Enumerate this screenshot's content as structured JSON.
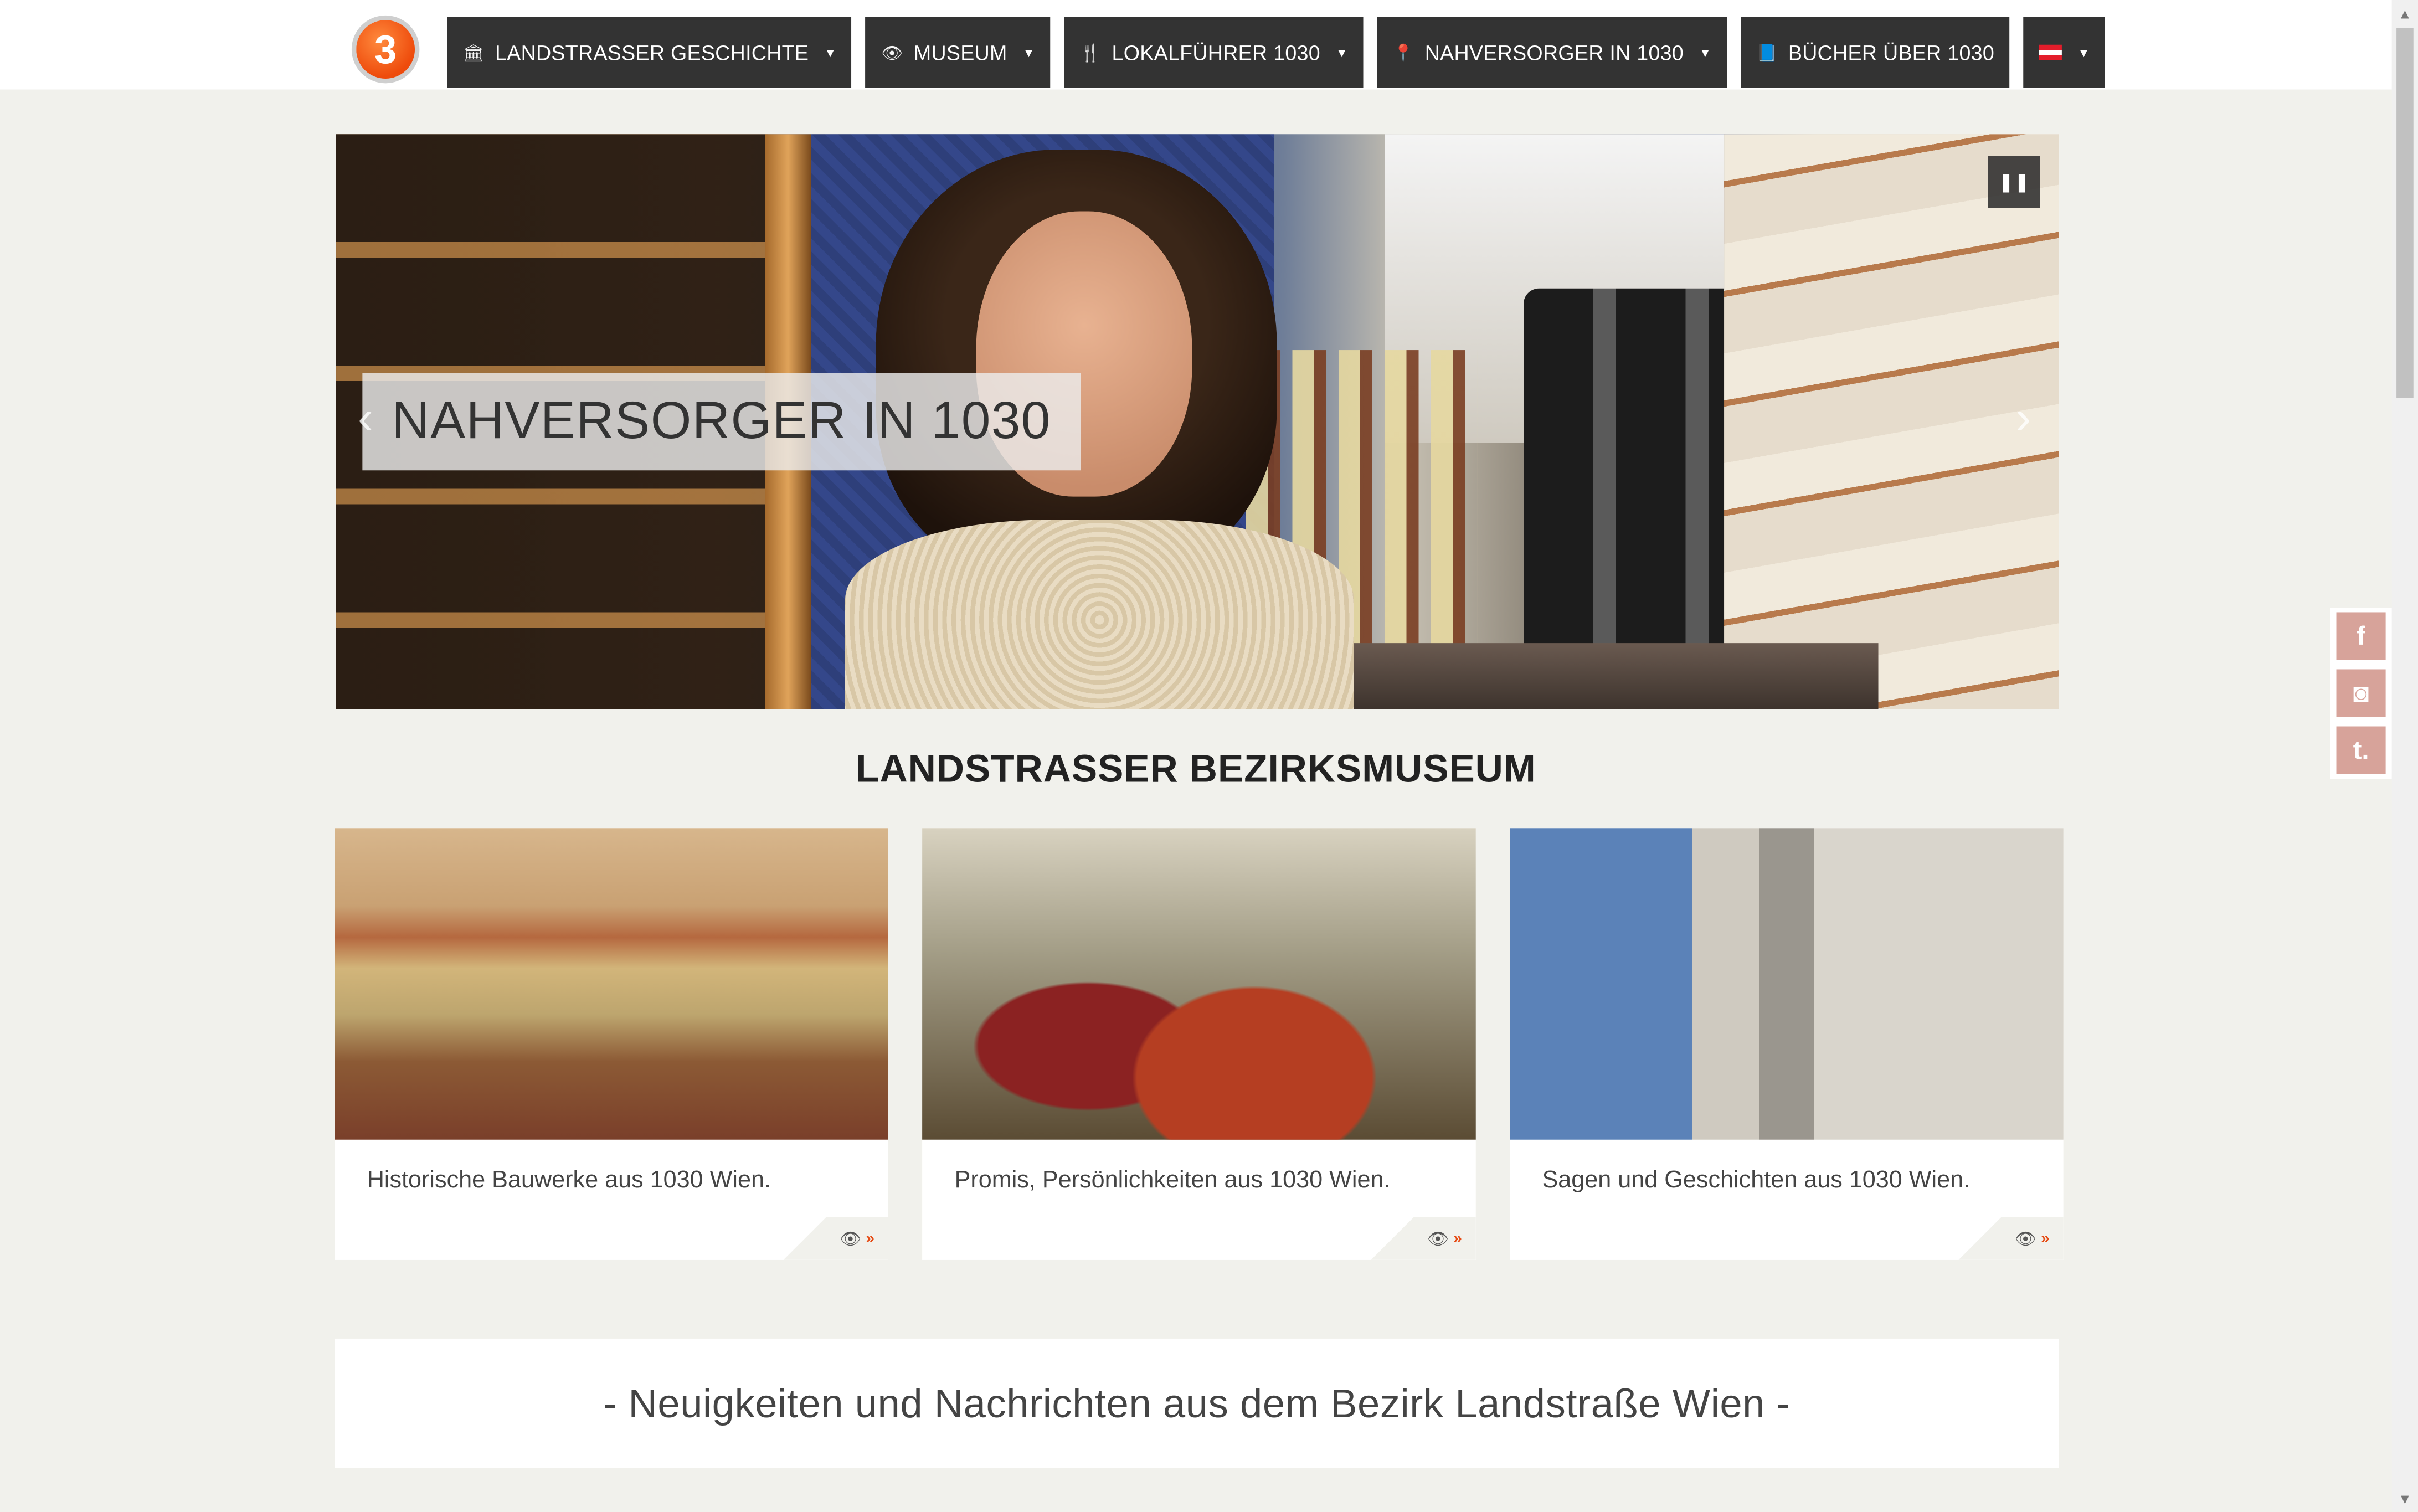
{
  "header": {
    "logo_text": "3",
    "nav": [
      {
        "icon": "museum-icon",
        "glyph": "🏛",
        "label": "LANDSTRASSER GESCHICHTE",
        "dropdown": true
      },
      {
        "icon": "eye-icon",
        "glyph": "👁",
        "label": "MUSEUM",
        "dropdown": true
      },
      {
        "icon": "cutlery-icon",
        "glyph": "🍴",
        "label": "LOKALFÜHRER 1030",
        "dropdown": true
      },
      {
        "icon": "map-pin-icon",
        "glyph": "📍",
        "label": "NAHVERSORGER IN 1030",
        "dropdown": true
      },
      {
        "icon": "book-icon",
        "glyph": "📘",
        "label": "BÜCHER ÜBER 1030",
        "dropdown": false
      },
      {
        "icon": "austria-flag-icon",
        "label": "",
        "dropdown": true
      }
    ]
  },
  "slider": {
    "caption": "NAHVERSORGER IN 1030",
    "prev_glyph": "‹",
    "next_glyph": "›",
    "pause_glyph": "❚❚"
  },
  "section": {
    "title": "LANDSTRASSER BEZIRKSMUSEUM",
    "cards": [
      {
        "text": "Historische Bauwerke aus 1030 Wien.",
        "more_glyph": "👁",
        "chevron": "»"
      },
      {
        "text": "Promis, Persönlichkeiten aus 1030 Wien.",
        "more_glyph": "👁",
        "chevron": "»"
      },
      {
        "text": "Sagen und Geschichten aus 1030 Wien.",
        "more_glyph": "👁",
        "chevron": "»"
      }
    ]
  },
  "news": {
    "heading": "- Neuigkeiten und Nachrichten aus dem Bezirk Landstraße Wien -"
  },
  "social": [
    {
      "name": "facebook-icon",
      "glyph": "f"
    },
    {
      "name": "instagram-icon",
      "glyph": "◙"
    },
    {
      "name": "tumblr-icon",
      "glyph": "t."
    }
  ],
  "colors": {
    "accent": "#e64b14",
    "nav_bg": "#333333",
    "page_bg": "#f1f1ec",
    "social_bg": "#d7a39a"
  }
}
